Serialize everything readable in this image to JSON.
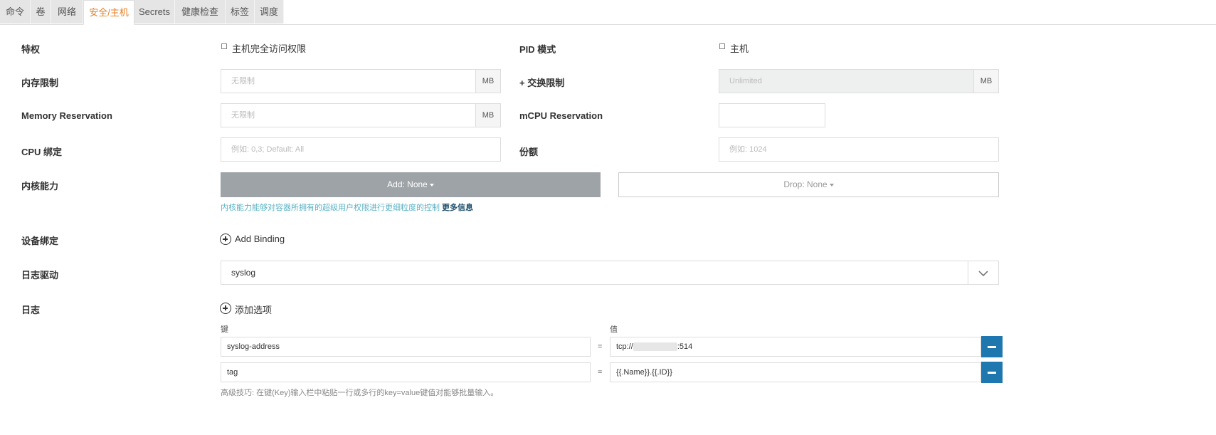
{
  "tabs": [
    "命令",
    "卷",
    "网络",
    "安全/主机",
    "Secrets",
    "健康检查",
    "标签",
    "调度"
  ],
  "form": {
    "privileged_label": "特权",
    "privileged_option": "主机完全访问权限",
    "pid_label": "PID 模式",
    "pid_option": "主机",
    "memory_label": "内存限制",
    "memory_placeholder": "无限制",
    "memory_unit": "MB",
    "swap_label": "+ 交换限制",
    "swap_placeholder": "Unlimited",
    "swap_unit": "MB",
    "mem_res_label": "Memory Reservation",
    "mem_res_placeholder": "无限制",
    "mem_res_unit": "MB",
    "mcpu_label": "mCPU Reservation",
    "cpu_bind_label": "CPU 绑定",
    "cpu_bind_placeholder": "例如: 0,3; Default: All",
    "shares_label": "份额",
    "shares_placeholder": "例如: 1024",
    "cap_label": "内核能力",
    "cap_add": "Add: None",
    "cap_drop": "Drop: None",
    "cap_hint": "内核能力能够对容器所拥有的超级用户权限进行更细粒度的控制",
    "cap_more": "更多信息",
    "device_label": "设备绑定",
    "device_add": "Add Binding",
    "log_driver_label": "日志驱动",
    "log_driver_value": "syslog",
    "log_label": "日志",
    "log_add": "添加选项",
    "key_header": "键",
    "value_header": "值",
    "equals": "=",
    "log_options": [
      {
        "key": "syslog-address",
        "value_prefix": "tcp://",
        "value_suffix": ":514"
      },
      {
        "key": "tag",
        "value_prefix": "{{.Name}}.{{.ID}}",
        "value_suffix": ""
      }
    ],
    "tip": "高级技巧: 在键(Key)输入栏中粘贴一行或多行的key=value键值对能够批量输入。"
  },
  "colors": {
    "accent": "#e67e22",
    "primary_button": "#1f77b0",
    "gray_button": "#9ea3a8",
    "hint": "#5bb2c6"
  }
}
